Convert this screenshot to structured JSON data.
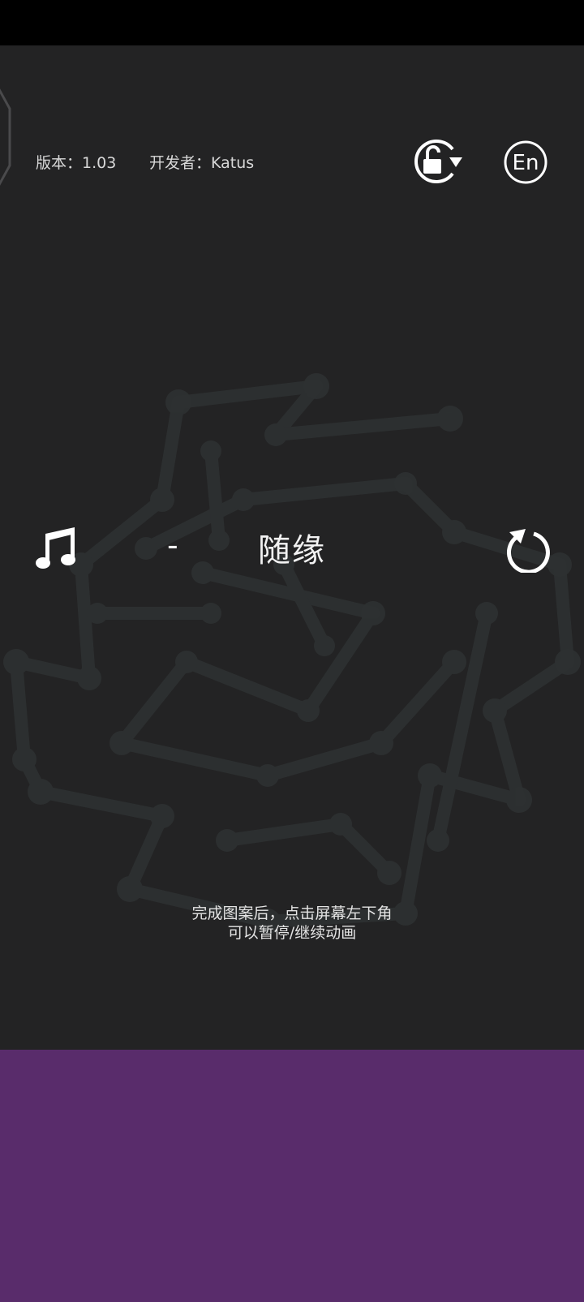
{
  "header": {
    "version_text": "版本：1.03",
    "developer_text": "开发者：Katus"
  },
  "icons": {
    "lock": "lock-rotate-icon",
    "language": "language-en-icon",
    "music": "music-note-icon",
    "reload": "reload-icon",
    "language_label": "En"
  },
  "song": {
    "separator": "-",
    "title": "随缘"
  },
  "hint": {
    "line1": "完成图案后，点击屏幕左下角",
    "line2": "可以暂停/继续动画"
  },
  "colors": {
    "canvas": "#232324",
    "panel": "#592c6b",
    "art": "#2e3132"
  }
}
